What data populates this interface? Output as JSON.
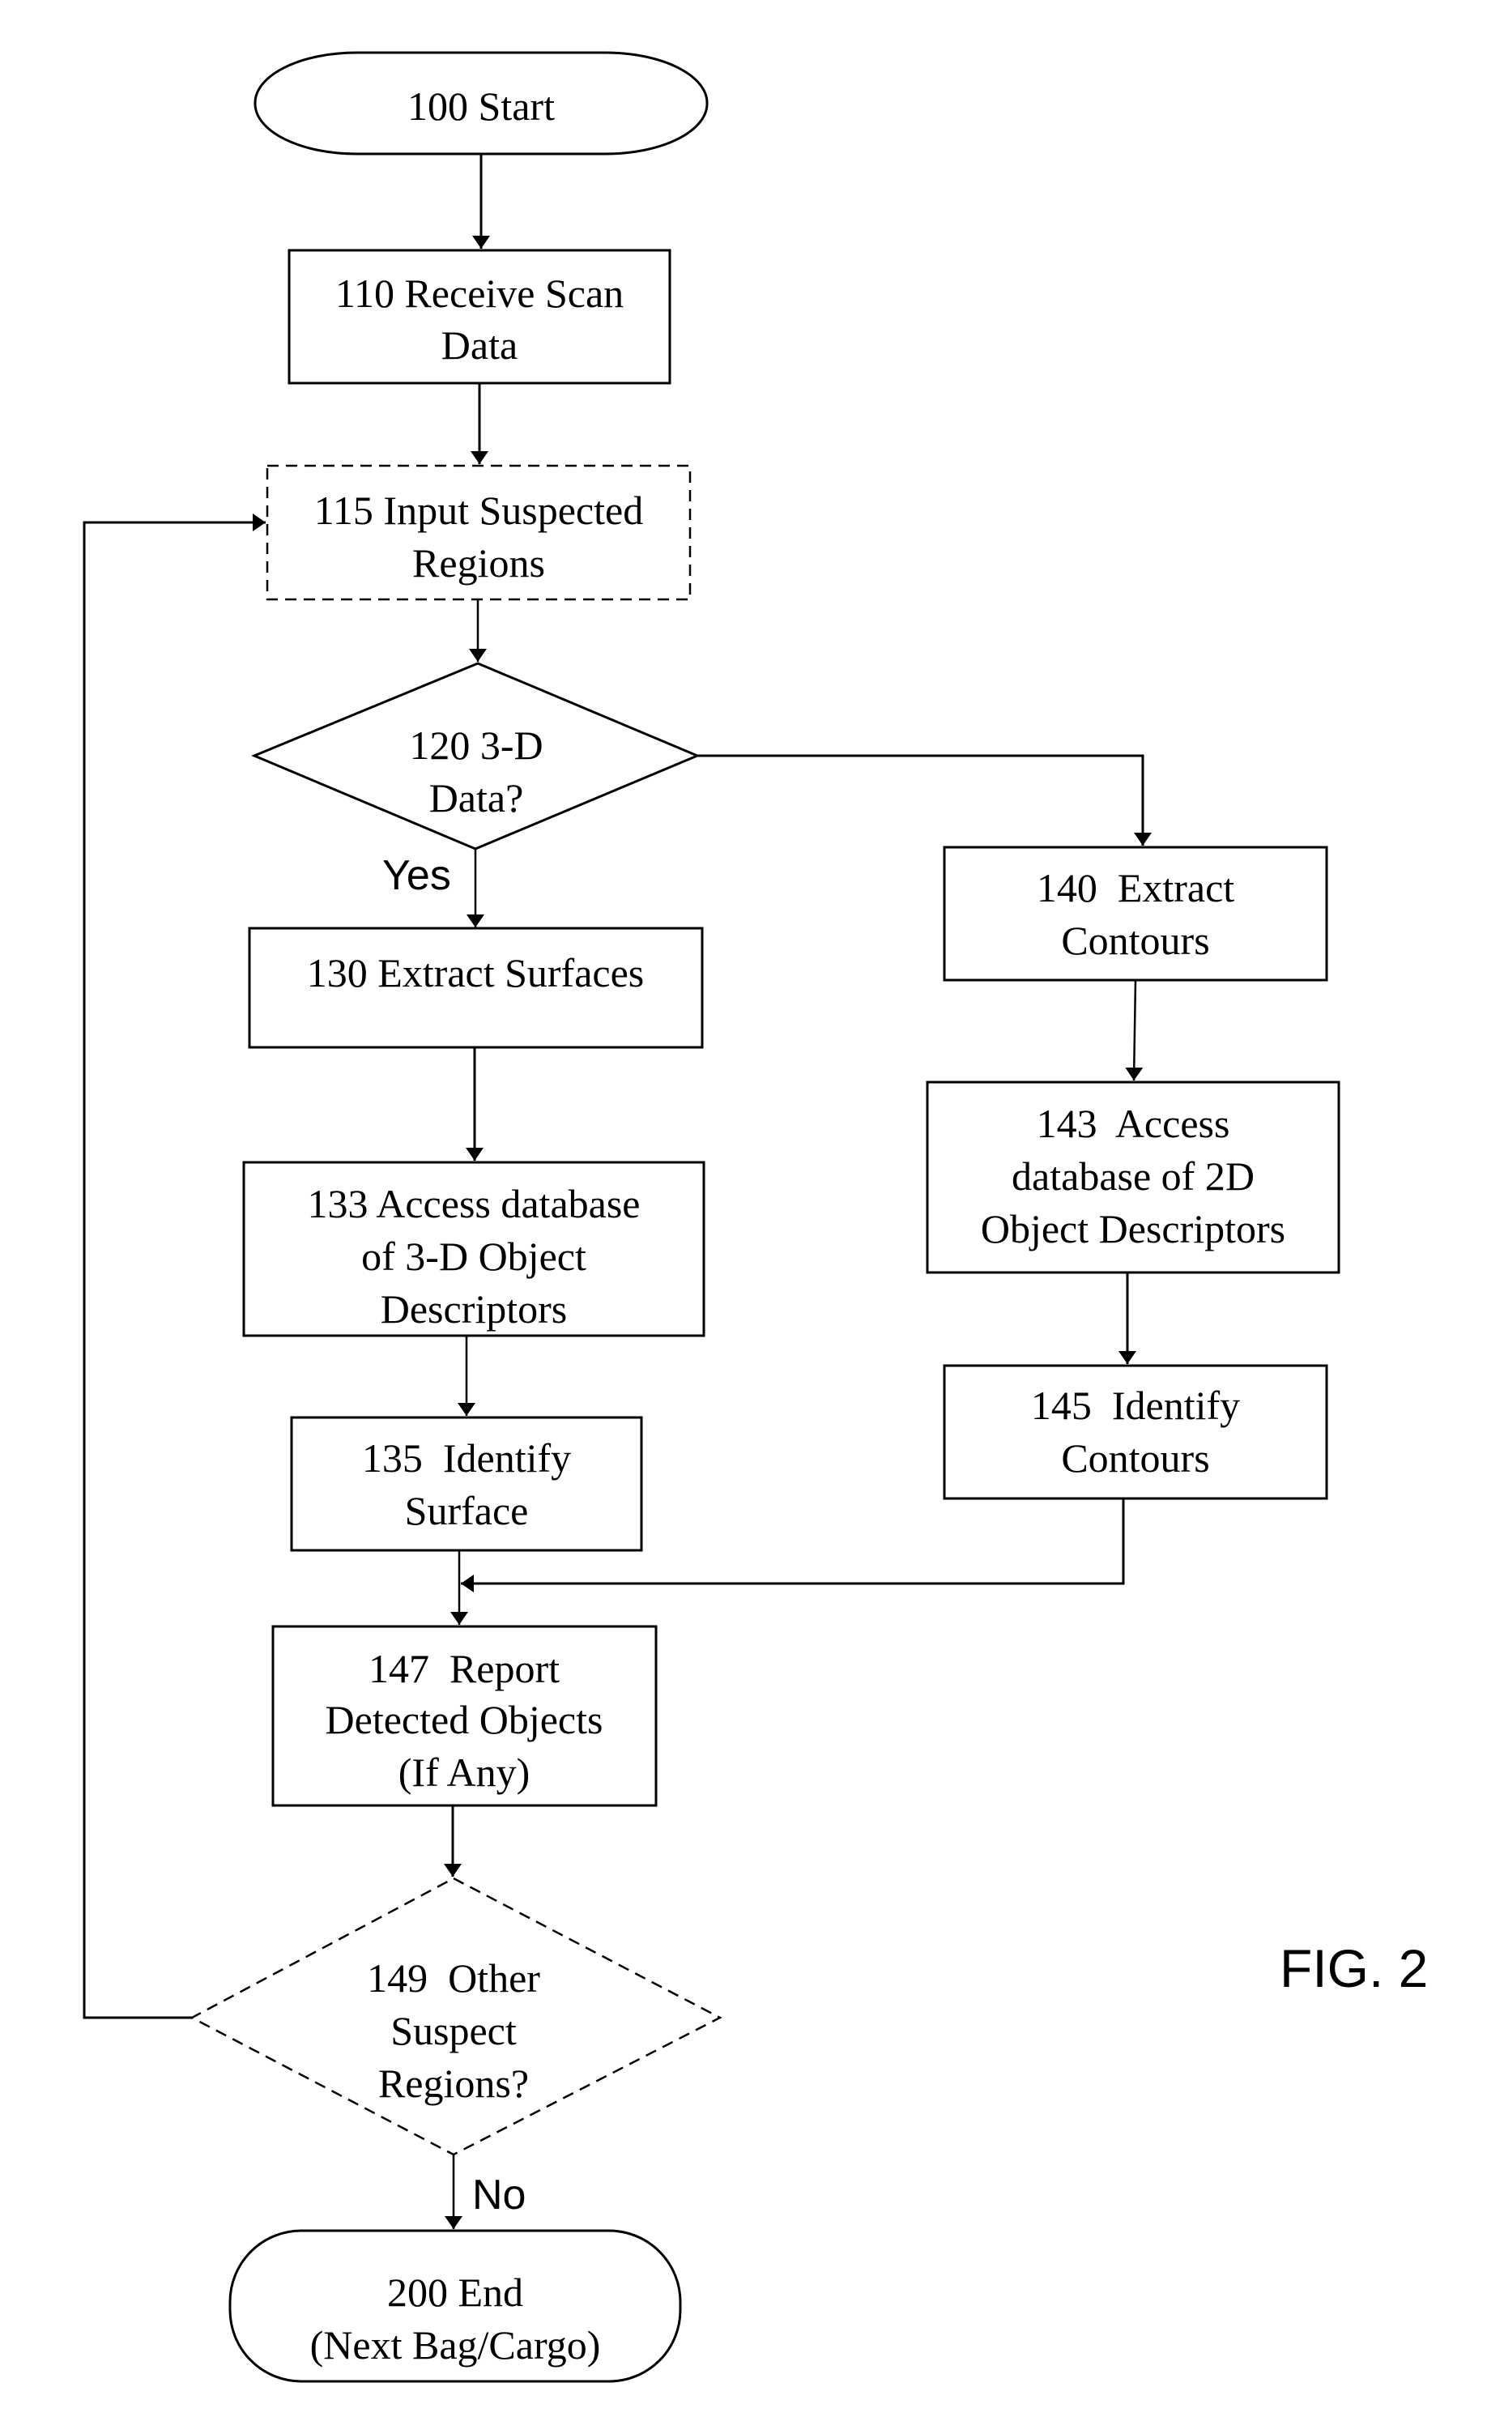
{
  "figure": {
    "label": "FIG. 2",
    "colors": {
      "stroke": "#000000",
      "background": "#ffffff"
    }
  },
  "nodes": {
    "n100": {
      "id": "100",
      "type": "terminal",
      "lines": [
        "100 Start"
      ]
    },
    "n110": {
      "id": "110",
      "type": "process",
      "lines": [
        "110 Receive Scan",
        "Data"
      ]
    },
    "n115": {
      "id": "115",
      "type": "process-optional",
      "style": "dashed",
      "lines": [
        "115 Input Suspected",
        "Regions"
      ]
    },
    "n120": {
      "id": "120",
      "type": "decision",
      "lines": [
        "120 3-D",
        "Data?"
      ]
    },
    "n130": {
      "id": "130",
      "type": "process",
      "lines": [
        "130 Extract Surfaces"
      ]
    },
    "n133": {
      "id": "133",
      "type": "process",
      "lines": [
        "133 Access database",
        "of 3-D Object",
        "Descriptors"
      ]
    },
    "n135": {
      "id": "135",
      "type": "process",
      "lines": [
        "135  Identify",
        "Surface"
      ]
    },
    "n140": {
      "id": "140",
      "type": "process",
      "lines": [
        "140  Extract",
        "Contours"
      ]
    },
    "n143": {
      "id": "143",
      "type": "process",
      "lines": [
        "143  Access",
        "database of 2D",
        "Object Descriptors"
      ]
    },
    "n145": {
      "id": "145",
      "type": "process",
      "lines": [
        "145  Identify",
        "Contours"
      ]
    },
    "n147": {
      "id": "147",
      "type": "process",
      "lines": [
        "147  Report",
        "Detected Objects",
        "(If Any)"
      ]
    },
    "n149": {
      "id": "149",
      "type": "decision-optional",
      "style": "dashed",
      "lines": [
        "149  Other",
        "Suspect",
        "Regions?"
      ]
    },
    "n200": {
      "id": "200",
      "type": "terminal",
      "lines": [
        "200 End",
        "(Next Bag/Cargo)"
      ]
    }
  },
  "edges": [
    {
      "from": "100",
      "to": "110",
      "label": ""
    },
    {
      "from": "110",
      "to": "115",
      "label": ""
    },
    {
      "from": "115",
      "to": "120",
      "label": ""
    },
    {
      "from": "120",
      "to": "130",
      "label": "Yes"
    },
    {
      "from": "120",
      "to": "140",
      "label": ""
    },
    {
      "from": "130",
      "to": "133",
      "label": ""
    },
    {
      "from": "133",
      "to": "135",
      "label": ""
    },
    {
      "from": "140",
      "to": "143",
      "label": ""
    },
    {
      "from": "143",
      "to": "145",
      "label": ""
    },
    {
      "from": "135",
      "to": "147",
      "label": ""
    },
    {
      "from": "145",
      "to": "147",
      "label": ""
    },
    {
      "from": "147",
      "to": "149",
      "label": ""
    },
    {
      "from": "149",
      "to": "115",
      "label": ""
    },
    {
      "from": "149",
      "to": "200",
      "label": "No"
    }
  ],
  "edge_labels": {
    "yes": "Yes",
    "no": "No"
  }
}
